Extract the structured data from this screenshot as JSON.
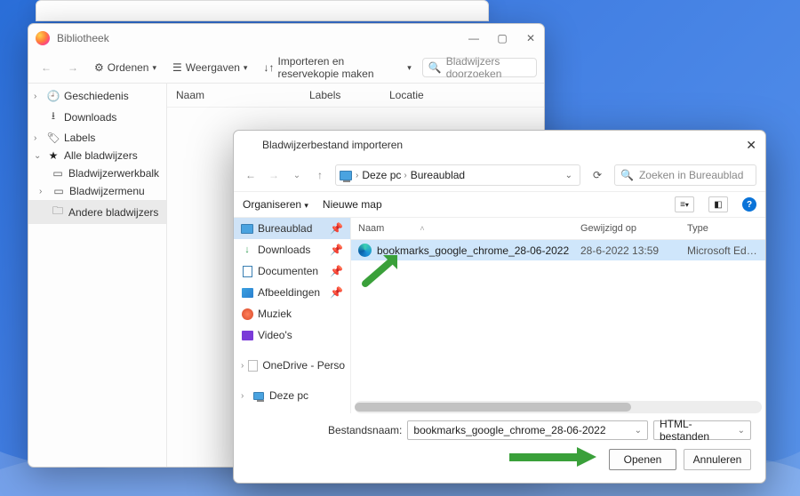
{
  "library": {
    "title": "Bibliotheek",
    "toolbar": {
      "organize": "Ordenen",
      "views": "Weergaven",
      "import": "Importeren en reservekopie maken",
      "search_placeholder": "Bladwijzers doorzoeken"
    },
    "columns": {
      "name": "Naam",
      "tags": "Labels",
      "location": "Locatie"
    },
    "side": {
      "history": "Geschiedenis",
      "downloads": "Downloads",
      "tags": "Labels",
      "all_bookmarks": "Alle bladwijzers",
      "toolbar_folder": "Bladwijzerwerkbalk",
      "menu_folder": "Bladwijzermenu",
      "other_folder": "Andere bladwijzers"
    }
  },
  "dialog": {
    "title": "Bladwijzerbestand importeren",
    "breadcrumb": {
      "root": "Deze pc",
      "folder": "Bureaublad"
    },
    "search_placeholder": "Zoeken in Bureaublad",
    "org_row": {
      "organize": "Organiseren",
      "new_folder": "Nieuwe map"
    },
    "side": {
      "desktop": "Bureaublad",
      "downloads": "Downloads",
      "documents": "Documenten",
      "pictures": "Afbeeldingen",
      "music": "Muziek",
      "videos": "Video's",
      "onedrive": "OneDrive - Perso",
      "this_pc": "Deze pc"
    },
    "list": {
      "col_name": "Naam",
      "col_modified": "Gewijzigd op",
      "col_type": "Type",
      "rows": [
        {
          "name": "bookmarks_google_chrome_28-06-2022",
          "modified": "28-6-2022 13:59",
          "type": "Microsoft Edge HTM…"
        }
      ]
    },
    "filename_label": "Bestandsnaam:",
    "filename_value": "bookmarks_google_chrome_28-06-2022",
    "filetype": "HTML-bestanden",
    "open_btn": "Openen",
    "cancel_btn": "Annuleren"
  }
}
